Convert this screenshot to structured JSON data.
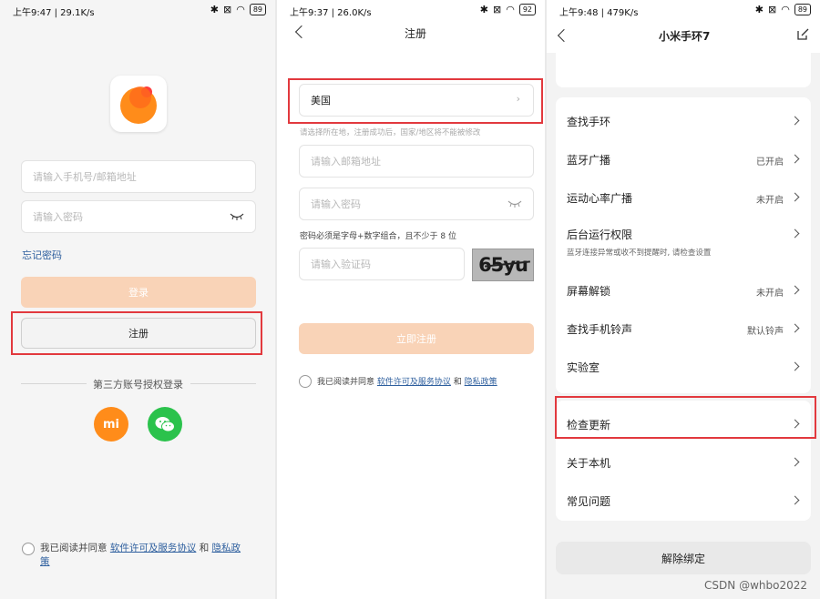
{
  "login": {
    "status": {
      "time": "上午9:47 | 29.1K/s",
      "battery": "89"
    },
    "account_placeholder": "请输入手机号/邮箱地址",
    "password_placeholder": "请输入密码",
    "forgot_password": "忘记密码",
    "login_button": "登录",
    "register_button": "注册",
    "third_party_title": "第三方账号授权登录",
    "xiaomi_icon_text": "mi",
    "agreement": {
      "prefix": "我已阅读并同意",
      "license": "软件许可及服务协议",
      "and": "和",
      "privacy": "隐私政",
      "privacy_end": "策"
    }
  },
  "register": {
    "status": {
      "time": "上午9:37 | 26.0K/s",
      "battery": "92"
    },
    "title": "注册",
    "region": "美国",
    "region_hint": "请选择所在地，注册成功后，国家/地区将不能被修改",
    "email_placeholder": "请输入邮箱地址",
    "password_placeholder": "请输入密码",
    "password_rule": "密码必须是字母+数字组合，且不少于 8 位",
    "captcha_placeholder": "请输入验证码",
    "captcha_text": "65yu",
    "submit_button": "立即注册",
    "agreement": {
      "prefix": "我已阅读并同意",
      "license": "软件许可及服务协议",
      "and": "和",
      "privacy": "隐私政策"
    }
  },
  "device": {
    "status": {
      "time": "上午9:48 | 479K/s",
      "battery": "89"
    },
    "title": "小米手环7",
    "card1_items": [
      {
        "label": "查找手环",
        "value": ""
      },
      {
        "label": "蓝牙广播",
        "value": "已开启"
      },
      {
        "label": "运动心率广播",
        "value": "未开启"
      },
      {
        "label": "后台运行权限",
        "value": "",
        "sub": "蓝牙连接异常或收不到提醒时, 请检查设置"
      },
      {
        "label": "屏幕解锁",
        "value": "未开启"
      },
      {
        "label": "查找手机铃声",
        "value": "默认铃声"
      },
      {
        "label": "实验室",
        "value": ""
      }
    ],
    "card2_items": [
      {
        "label": "检查更新"
      },
      {
        "label": "关于本机"
      },
      {
        "label": "常见问题"
      }
    ],
    "unbind_button": "解除绑定"
  },
  "watermark": "CSDN @whbo2022",
  "colors": {
    "accent_orange": "#ff8c1a",
    "disabled_orange": "#f9d3b7",
    "wechat_green": "#2bc24c",
    "highlight_red": "#e2393e",
    "link_blue": "#2e5f9e"
  }
}
